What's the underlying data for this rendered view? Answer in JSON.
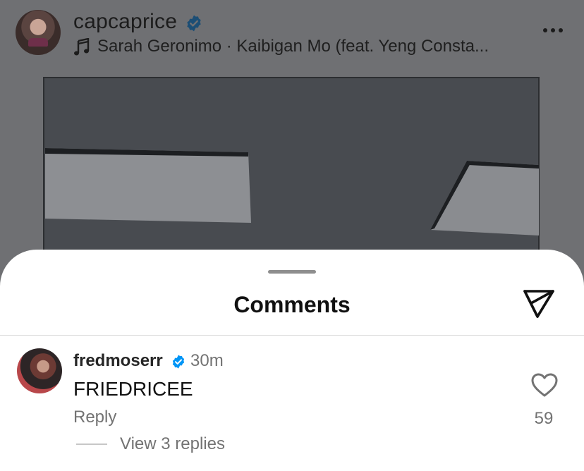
{
  "post": {
    "username": "capcaprice",
    "verified": true,
    "audio": "Sarah Geronimo · Kaibigan Mo (feat. Yeng Consta...",
    "more_icon": "more-horizontal-icon",
    "music_icon": "music-note-icon"
  },
  "sheet": {
    "title": "Comments",
    "share_icon": "send-icon"
  },
  "comments": [
    {
      "username": "fredmoserr",
      "verified": true,
      "time": "30m",
      "text": "FRIEDRICEE",
      "reply_label": "Reply",
      "like_icon": "heart-outline-icon",
      "likes": "59",
      "view_replies": "View 3 replies"
    }
  ],
  "colors": {
    "verified_blue": "#0095f6",
    "dim_overlay": "#6f7073",
    "secondary_text": "#737373"
  }
}
